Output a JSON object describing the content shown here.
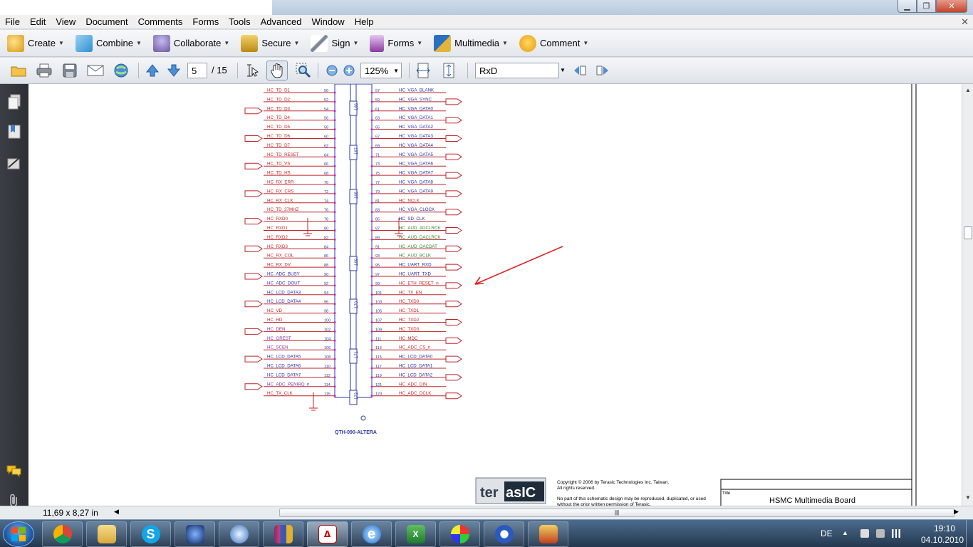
{
  "menu": {
    "items": [
      "File",
      "Edit",
      "View",
      "Document",
      "Comments",
      "Forms",
      "Tools",
      "Advanced",
      "Window",
      "Help"
    ]
  },
  "tasks": [
    {
      "label": "Create",
      "icon": "create-icon",
      "color": "#e0a020"
    },
    {
      "label": "Combine",
      "icon": "combine-icon",
      "color": "#2f8fd0"
    },
    {
      "label": "Collaborate",
      "icon": "collaborate-icon",
      "color": "#7a6ab0"
    },
    {
      "label": "Secure",
      "icon": "lock-icon",
      "color": "#c09020"
    },
    {
      "label": "Sign",
      "icon": "pen-icon",
      "color": "#6d7a8a"
    },
    {
      "label": "Forms",
      "icon": "forms-icon",
      "color": "#8a3aa0"
    },
    {
      "label": "Multimedia",
      "icon": "multimedia-icon",
      "color": "#d0a030"
    },
    {
      "label": "Comment",
      "icon": "comment-icon",
      "color": "#f0a020"
    }
  ],
  "toolbar": {
    "page_current": "5",
    "page_total": "/ 15",
    "zoom": "125%",
    "search_text": "RxD"
  },
  "status": {
    "page_size": "11,69 x 8,27 in"
  },
  "schematic": {
    "left_labels": [
      "HC_TD_D1",
      "HC_TD_D2",
      "HC_TD_D3",
      "HC_TD_D4",
      "HC_TD_D5",
      "HC_TD_D6",
      "HC_TD_D7",
      "HC_TD_RESET",
      "HC_TD_VS",
      "HC_TD_HS",
      "HC_RX_ERR",
      "HC_RX_CRS",
      "HC_RX_CLK",
      "HC_TD_27MHZ",
      "HC_RXD0",
      "HC_RXD1",
      "HC_RXD2",
      "HC_RXD3",
      "HC_RX_COL",
      "HC_RX_DV",
      "HC_ADC_BUSY",
      "HC_ADC_DOUT",
      "HC_LCD_DATA3",
      "HC_LCD_DATA4",
      "HC_VD",
      "HC_HD",
      "HC_DEN",
      "HC_GREST",
      "HC_SCEN",
      "HC_LCD_DATA5",
      "HC_LCD_DATA6",
      "HC_LCD_DATA7",
      "HC_ADC_PENIRQ_n",
      "HC_TX_CLK"
    ],
    "right_labels": [
      "HC_VGA_BLANK",
      "HC_VGA_SYNC",
      "HC_VGA_DATA0",
      "HC_VGA_DATA1",
      "HC_VGA_DATA2",
      "HC_VGA_DATA3",
      "HC_VGA_DATA4",
      "HC_VGA_DATA5",
      "HC_VGA_DATA6",
      "HC_VGA_DATA7",
      "HC_VGA_DATA8",
      "HC_VGA_DATA9",
      "HC_NCLK",
      "HC_VGA_CLOCK",
      "HC_SD_CLK",
      "HC_AUD_ADCLRCK",
      "HC_AUD_DACLRCK",
      "HC_AUD_DACDAT",
      "HC_AUD_BCLK",
      "HC_UART_RXD",
      "HC_UART_TXD",
      "HC_ETH_RESET_n",
      "HC_TX_EN",
      "HC_TXD0",
      "HC_TXD1",
      "HC_TXD2",
      "HC_TXD3",
      "HC_MDC",
      "HC_ADC_CS_n",
      "HC_LCD_DATA0",
      "HC_LCD_DATA1",
      "HC_LCD_DATA2",
      "HC_ADC_DIN",
      "HC_ADC_DCLK"
    ],
    "bank_labels": [
      "166",
      "167",
      "168",
      "169",
      "170",
      "171",
      "172"
    ],
    "part_name": "QTH-090-ALTERA",
    "logo_left": "ter",
    "logo_right": "asIC",
    "copyright_line1": "Copyright © 2006 by Terasic Technologies Inc. Taiwan.",
    "copyright_line2": "All rights reserved.",
    "notice_line1": "No part of this schematic design may be reproduced, duplicated, or used",
    "notice_line2": "without the prior written permission of Terasic.",
    "title_label": "Title",
    "board_title": "HSMC Multimedia Board"
  },
  "tray": {
    "language": "DE",
    "time": "19:10",
    "date": "04.10.2010"
  },
  "colors": {
    "wire": "#c0252a",
    "connector": "#2a3aa8",
    "label_blue": "#2630b0",
    "label_orange": "#d26a10",
    "label_green": "#2f8a2f",
    "label_purple": "#7a2aa0",
    "pin_dot": "#d020d0",
    "arrow": "#e02020"
  }
}
